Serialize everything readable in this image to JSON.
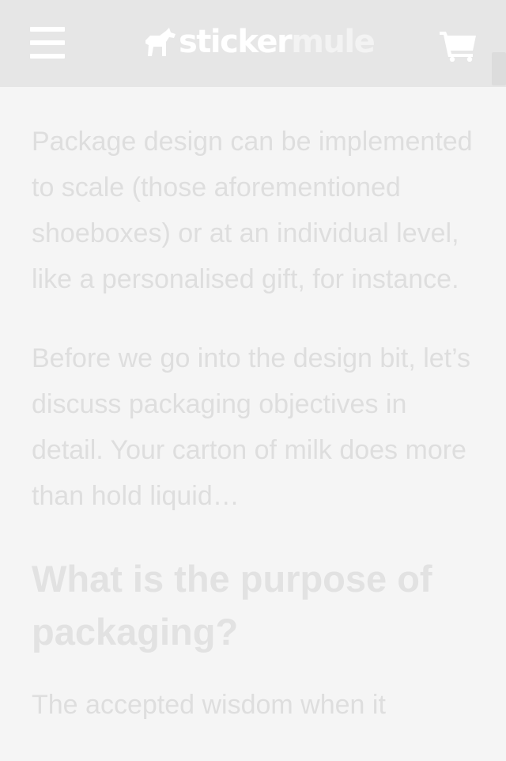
{
  "header": {
    "logo": {
      "part1": "sticker",
      "part2": "mule"
    },
    "menu_icon": "hamburger-menu-icon",
    "cart_icon": "shopping-cart-icon"
  },
  "article": {
    "paragraph1": "Package design can be implemented to scale (those aforementioned shoeboxes) or at an individual level, like a personalised gift, for instance.",
    "paragraph2": "Before we go into the design bit, let’s discuss packaging objectives in detail. Your carton of milk does more than hold liquid…",
    "heading": "What is the purpose of packaging?",
    "paragraph3": "The accepted wisdom when it"
  },
  "colors": {
    "header_bg": "#e6e6e6",
    "page_bg": "#f5f5f5",
    "text": "#dedede"
  }
}
